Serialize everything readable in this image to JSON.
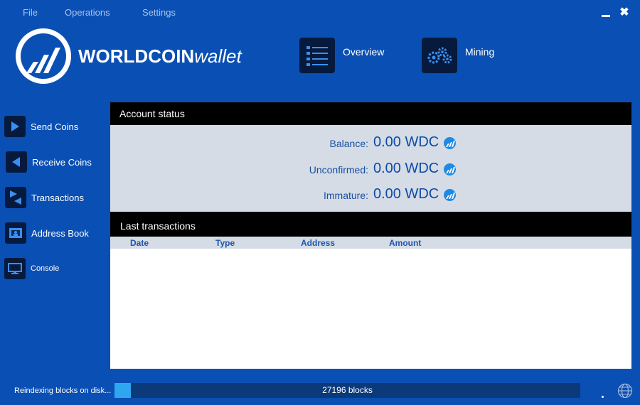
{
  "menu": {
    "file": "File",
    "operations": "Operations",
    "settings": "Settings"
  },
  "window_controls": {
    "minimize_icon": "minimize-icon",
    "close_icon": "close-icon",
    "close_symbol": "✖"
  },
  "brand": {
    "bold": "WORLDCOIN",
    "italic": "wallet"
  },
  "top_tabs": [
    {
      "label": "Overview",
      "icon": "list-icon"
    },
    {
      "label": "Mining",
      "icon": "gears-icon"
    }
  ],
  "sidebar": {
    "items": [
      {
        "label": "Send Coins",
        "icon": "send-arrow-icon"
      },
      {
        "label": "Receive Coins",
        "icon": "receive-arrow-icon"
      },
      {
        "label": "Transactions",
        "icon": "transactions-icon"
      },
      {
        "label": "Address Book",
        "icon": "address-book-icon"
      },
      {
        "label": "Console",
        "icon": "monitor-icon"
      }
    ]
  },
  "account_status": {
    "title": "Account status",
    "rows": [
      {
        "label": "Balance:",
        "value": "0.00 WDC"
      },
      {
        "label": "Unconfirmed:",
        "value": "0.00 WDC"
      },
      {
        "label": "Immature:",
        "value": "0.00 WDC"
      }
    ]
  },
  "last_transactions": {
    "title": "Last transactions",
    "columns": [
      "Date",
      "Type",
      "Address",
      "Amount"
    ],
    "rows": []
  },
  "status_bar": {
    "message": "Reindexing blocks on disk...",
    "progress_text": "27196 blocks",
    "progress_fraction": 0.035
  },
  "colors": {
    "background": "#0a4fb4",
    "header_black": "#000000",
    "panel_grey": "#d5dce6",
    "accent_text": "#0d4aa6",
    "progress_fill": "#2ea7f0",
    "progress_track": "#0b3a7a"
  }
}
